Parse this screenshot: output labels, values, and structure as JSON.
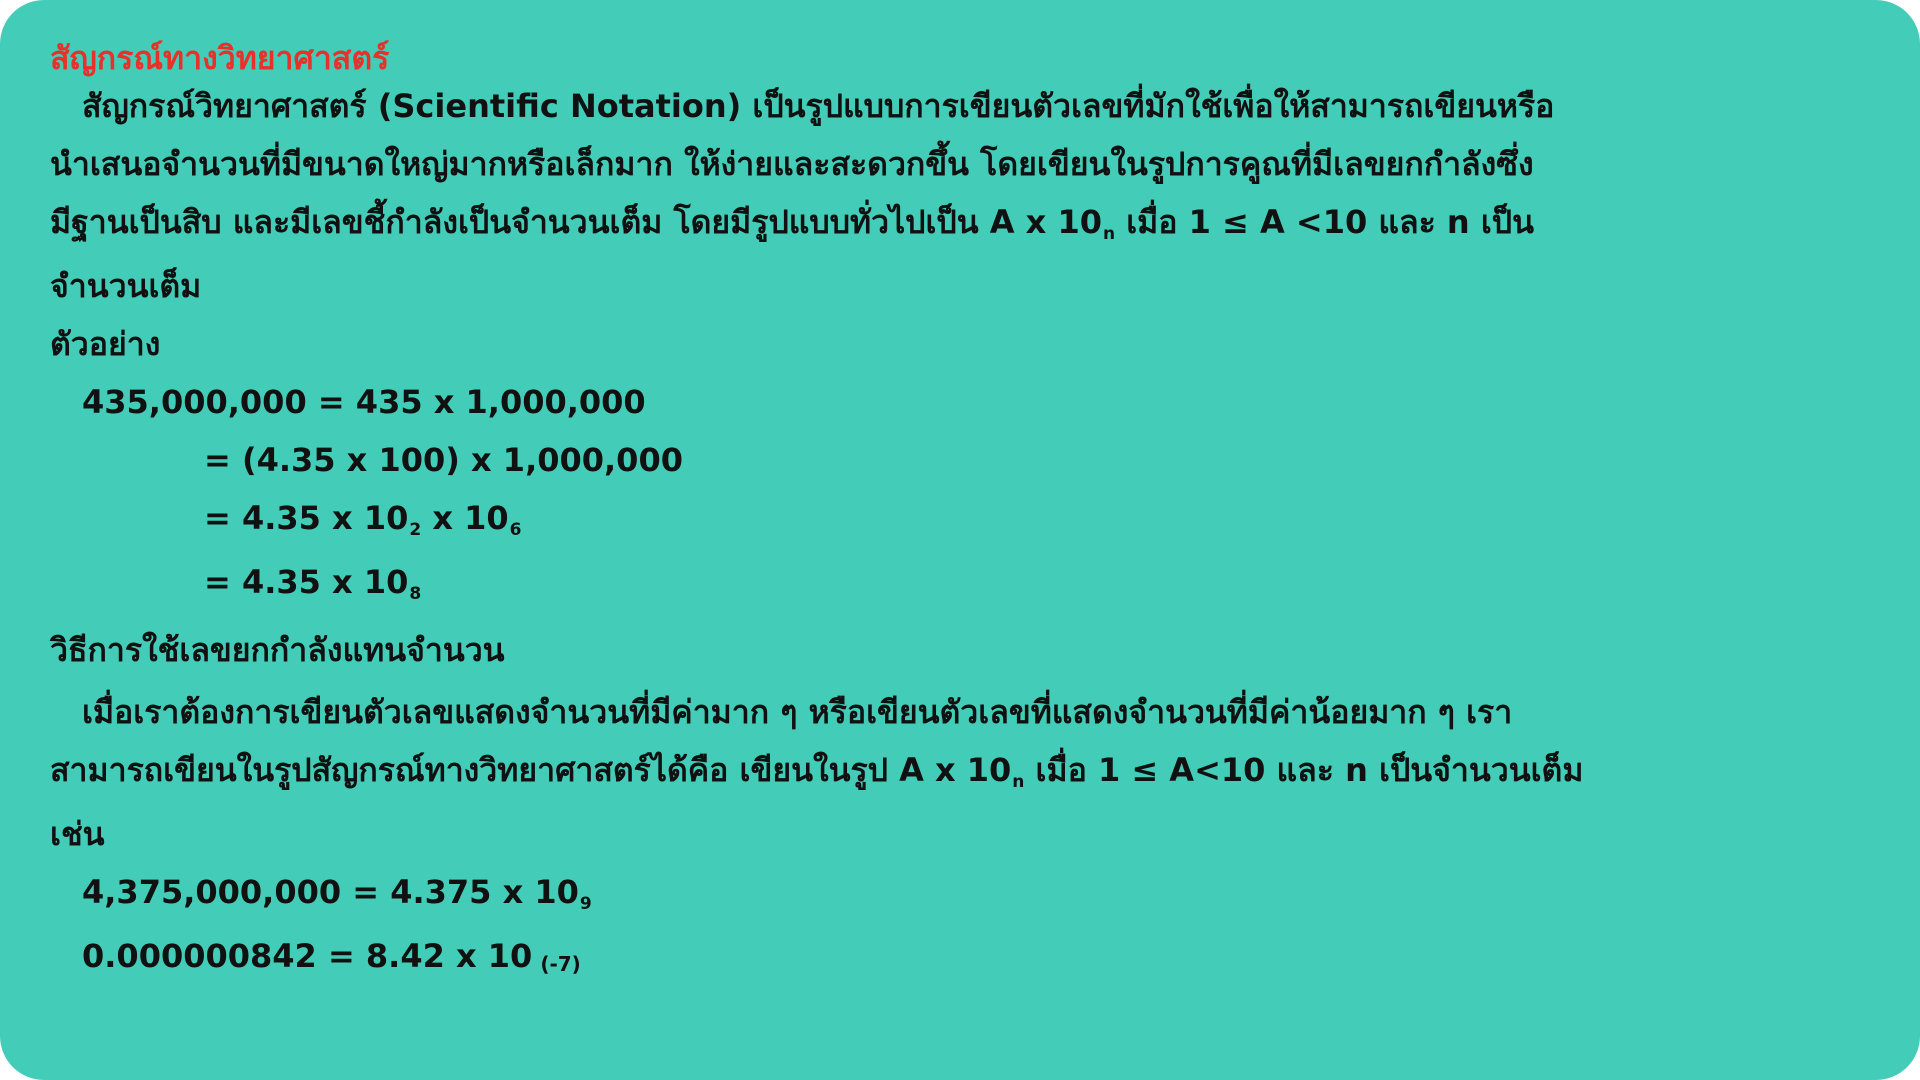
{
  "title": "สัญกรณ์ทางวิทยาศาสตร์",
  "intro": {
    "line1": "สัญกรณ์วิทยาศาสตร์ (Scientific Notation) เป็นรูปแบบการเขียนตัวเลขที่มักใช้เพื่อให้สามารถเขียนหรือ",
    "line2": "นำเสนอจำนวนที่มีขนาดใหญ่มากหรือเล็กมาก ให้ง่ายและสะดวกขึ้น โดยเขียนในรูปการคูณที่มีเลขยกกำลังซึ่ง",
    "line3_a": "มีฐานเป็นสิบ และมีเลขชี้กำลังเป็นจำนวนเต็ม โดยมีรูปแบบทั่วไปเป็น A x 10",
    "line3_sub": "n",
    "line3_b": " เมื่อ 1 ≤ A <10 และ n เป็น",
    "line4": "จำนวนเต็ม"
  },
  "example_heading": "ตัวอย่าง",
  "example": {
    "step1": "435,000,000 = 435 x 1,000,000",
    "step2": "= (4.35 x 100) x 1,000,000",
    "step3_a": "= 4.35 x 10",
    "step3_sub1": "2",
    "step3_b": " x 10",
    "step3_sub2": "6",
    "step4_a": "= 4.35 x 10",
    "step4_sub": "8"
  },
  "method_heading": "วิธีการใช้เลขยกกำลังแทนจำนวน",
  "method": {
    "line1": "เมื่อเราต้องการเขียนตัวเลขแสดงจำนวนที่มีค่ามาก ๆ หรือเขียนตัวเลขที่แสดงจำนวนที่มีค่าน้อยมาก ๆ เรา",
    "line2_a": "สามารถเขียนในรูปสัญกรณ์ทางวิทยาศาสตร์ได้คือ เขียนในรูป A x 10",
    "line2_sub": "n",
    "line2_b": " เมื่อ 1 ≤ A<10 และ n เป็นจำนวนเต็ม",
    "line3": "เช่น"
  },
  "examples2": {
    "ex1_a": "4,375,000,000 = 4.375 x 10",
    "ex1_sub": "9",
    "ex2_a": "0.000000842 = 8.42 x 10",
    "ex2_sub": "(-7)"
  },
  "colors": {
    "background": "#43cdb9",
    "title": "#e8312a",
    "text": "#111111"
  }
}
